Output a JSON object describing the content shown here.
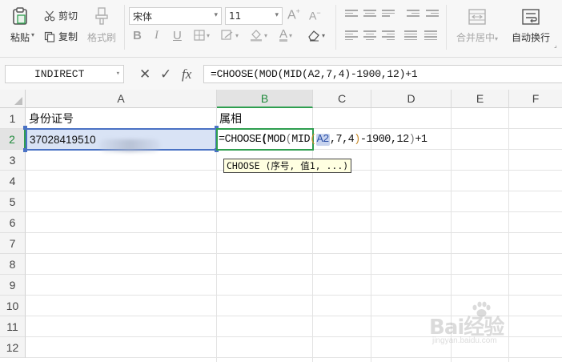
{
  "ribbon": {
    "paste": "粘贴",
    "cut": "剪切",
    "copy": "复制",
    "format_painter": "格式刷",
    "font_name": "宋体",
    "font_size": "11",
    "bold": "B",
    "italic": "I",
    "underline": "U",
    "font_color_glyph": "A",
    "merge_center": "合并居中",
    "wrap_text": "自动换行"
  },
  "formula_bar": {
    "name_box": "INDIRECT",
    "cancel_glyph": "✕",
    "enter_glyph": "✓",
    "fx_label": "fx",
    "formula": "=CHOOSE(MOD(MID(A2,7,4)-1900,12)+1"
  },
  "grid": {
    "columns": [
      "A",
      "B",
      "C",
      "D",
      "E",
      "F"
    ],
    "rows": [
      "1",
      "2",
      "3",
      "4",
      "5",
      "6",
      "7",
      "8",
      "9",
      "10",
      "11",
      "12"
    ],
    "cells": {
      "A1": "身份证号",
      "B1": "属相",
      "A2": "37028419510"
    },
    "b2_edit": {
      "p1": "=CHOOSE",
      "p2": "(",
      "p3": "MOD",
      "p4": "(",
      "p5": "MID",
      "p6": "(",
      "p7": "A2",
      "p8": ",7,4",
      "p9": ")",
      "p10": "-1900,12",
      "p11": ")",
      "p12": "+1"
    },
    "tooltip": "CHOOSE (序号, 值1, ...)"
  },
  "watermark": {
    "main": "Bai经验",
    "sub": "jingyan.baidu.com"
  },
  "colors": {
    "active_green": "#2e9e4f",
    "selection_blue": "#4a72c4",
    "tooltip_bg": "#ffffe1"
  }
}
